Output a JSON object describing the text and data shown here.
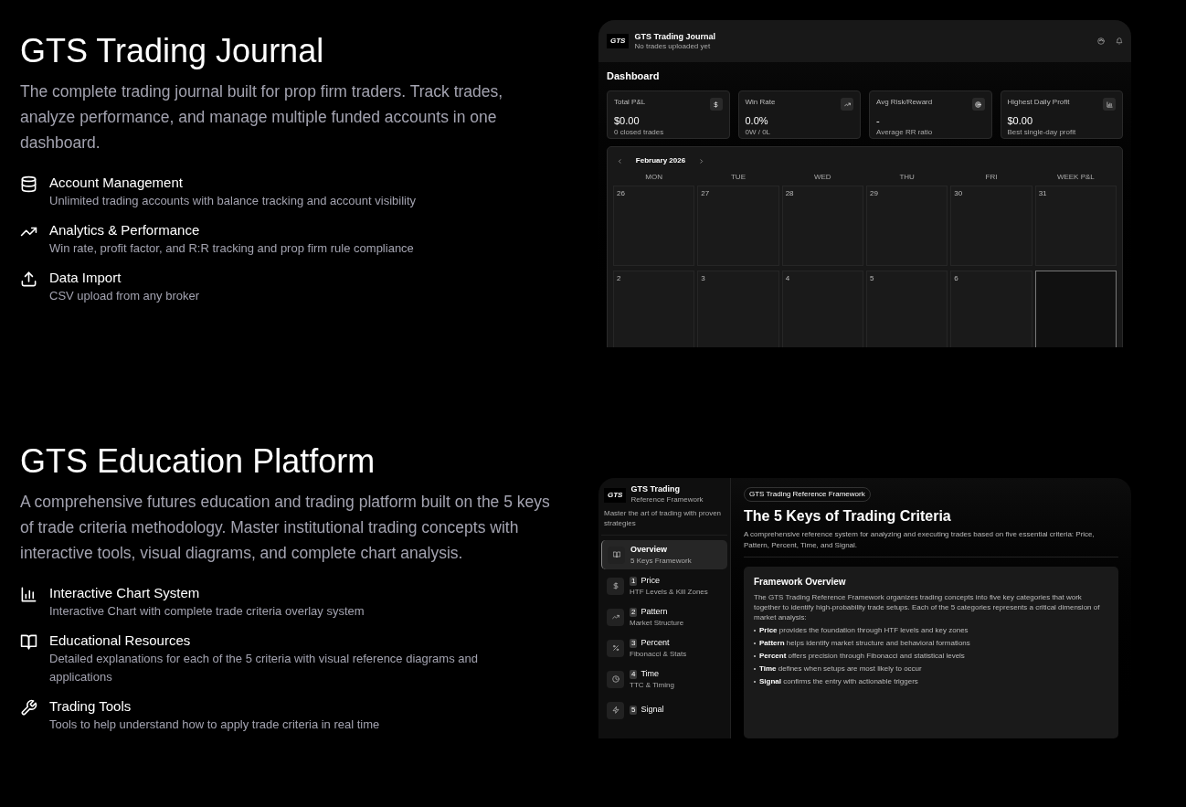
{
  "products": [
    {
      "title": "GTS Trading Journal",
      "description": "The complete trading journal built for prop firm traders. Track trades, analyze performance, and manage multiple funded accounts in one dashboard.",
      "features": [
        {
          "kind": "database",
          "title": "Account Management",
          "description": "Unlimited trading accounts with balance tracking and account visibility"
        },
        {
          "kind": "trending",
          "title": "Analytics & Performance",
          "description": "Win rate, profit factor, and R:R tracking and prop firm rule compliance"
        },
        {
          "kind": "upload",
          "title": "Data Import",
          "description": "CSV upload from any broker"
        }
      ],
      "preview": {
        "kind": "journal",
        "logo": "GTS",
        "app_title": "GTS Trading Journal",
        "app_subtitle": "No trades uploaded yet",
        "page_title": "Dashboard",
        "stats": [
          {
            "kind": "dollar",
            "label": "Total P&L",
            "value": "$0.00",
            "caption": "0 closed trades"
          },
          {
            "kind": "trending",
            "label": "Win Rate",
            "value": "0.0%",
            "caption": "0W / 0L"
          },
          {
            "kind": "target",
            "label": "Avg Risk/Reward",
            "value": "-",
            "caption": "Average RR ratio"
          },
          {
            "kind": "chart",
            "label": "Highest Daily Profit",
            "value": "$0.00",
            "caption": "Best single-day profit"
          }
        ],
        "calendar": {
          "month": "February 2026",
          "weekdays": [
            "MON",
            "TUE",
            "WED",
            "THU",
            "FRI",
            "WEEK P&L"
          ],
          "weeks": [
            [
              {
                "day": "26",
                "selected": false
              },
              {
                "day": "27",
                "selected": false
              },
              {
                "day": "28",
                "selected": false
              },
              {
                "day": "29",
                "selected": false
              },
              {
                "day": "30",
                "selected": false
              },
              {
                "day": "31",
                "selected": false
              }
            ],
            [
              {
                "day": "2",
                "selected": false
              },
              {
                "day": "3",
                "selected": false
              },
              {
                "day": "4",
                "selected": false
              },
              {
                "day": "5",
                "selected": false
              },
              {
                "day": "6",
                "selected": false
              },
              {
                "selected": true
              }
            ]
          ]
        }
      }
    },
    {
      "title": "GTS Education Platform",
      "description": "A comprehensive futures education and trading platform built on the 5 keys of trade criteria methodology. Master institutional trading concepts with interactive tools, visual diagrams, and complete chart analysis.",
      "features": [
        {
          "kind": "chart",
          "title": "Interactive Chart System",
          "description": "Interactive Chart with complete trade criteria overlay system"
        },
        {
          "kind": "book",
          "title": "Educational Resources",
          "description": "Detailed explanations for each of the 5 criteria with visual reference diagrams and applications"
        },
        {
          "kind": "wrench",
          "title": "Trading Tools",
          "description": "Tools to help understand how to apply trade criteria in real time"
        }
      ],
      "preview": {
        "kind": "education",
        "logo": "GTS",
        "brand_title": "GTS Trading",
        "brand_subtitle": "Reference Framework",
        "tagline": "Master the art of trading with proven strategies",
        "nav": [
          {
            "kind": "book",
            "title": "Overview",
            "subtitle": "5 Keys Framework",
            "selected": true
          },
          {
            "kind": "dollar",
            "number": "1",
            "title": "Price",
            "subtitle": "HTF Levels & Kill Zones",
            "selected": false
          },
          {
            "kind": "trending",
            "number": "2",
            "title": "Pattern",
            "subtitle": "Market Structure",
            "selected": false
          },
          {
            "kind": "percent",
            "number": "3",
            "title": "Percent",
            "subtitle": "Fibonacci & Stats",
            "selected": false
          },
          {
            "kind": "clock",
            "number": "4",
            "title": "Time",
            "subtitle": "TTC & Timing",
            "selected": false
          },
          {
            "kind": "signal",
            "number": "5",
            "title": "Signal",
            "selected": false
          }
        ],
        "badge": "GTS Trading Reference Framework",
        "heading": "The 5 Keys of Trading Criteria",
        "intro": "A comprehensive reference system for analyzing and executing trades based on five essential criteria: Price, Pattern, Percent, Time, and Signal.",
        "card": {
          "title": "Framework Overview",
          "paragraph": "The GTS Trading Reference Framework organizes trading concepts into five key categories that work together to identify high-probability trade setups. Each of the 5 categories represents a critical dimension of market analysis:",
          "bullets": [
            "**Price** provides the foundation through HTF levels and key zones",
            "**Pattern** helps identify market structure and behavioral formations",
            "**Percent** offers precision through Fibonacci and statistical levels",
            "**Time** defines when setups are most likely to occur",
            "**Signal** confirms the entry with actionable triggers"
          ]
        }
      }
    }
  ]
}
